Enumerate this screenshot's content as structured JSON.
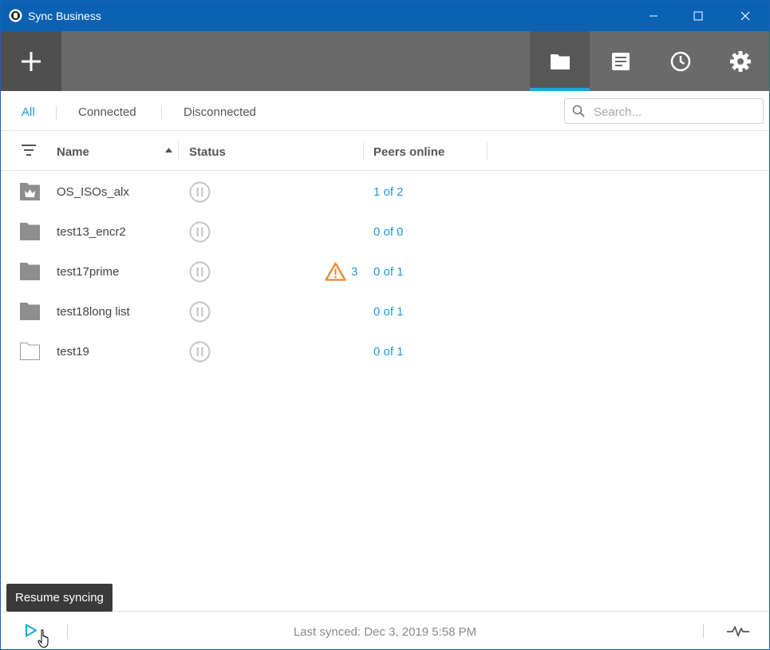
{
  "window": {
    "title": "Sync Business"
  },
  "toolbar": {
    "add_icon": "plus-icon",
    "tabs": [
      {
        "name": "folders",
        "icon": "folder-icon",
        "active": true
      },
      {
        "name": "notes",
        "icon": "notes-icon",
        "active": false
      },
      {
        "name": "history",
        "icon": "clock-icon",
        "active": false
      },
      {
        "name": "settings",
        "icon": "gear-icon",
        "active": false
      }
    ]
  },
  "filters": {
    "tabs": [
      "All",
      "Connected",
      "Disconnected"
    ],
    "active": "All"
  },
  "search": {
    "placeholder": "Search..."
  },
  "table": {
    "columns": {
      "name": "Name",
      "status": "Status",
      "peers": "Peers online"
    },
    "rows": [
      {
        "name": "OS_ISOs_alx",
        "folder_icon": "shared-folder-crown-icon",
        "status": "paused",
        "warnings": "",
        "peers": "1 of 2"
      },
      {
        "name": "test13_encr2",
        "folder_icon": "folder-icon",
        "status": "paused",
        "warnings": "",
        "peers": "0 of 0"
      },
      {
        "name": "test17prime",
        "folder_icon": "folder-icon",
        "status": "paused",
        "warnings": "3",
        "peers": "0 of 1"
      },
      {
        "name": "test18long list",
        "folder_icon": "folder-icon",
        "status": "paused",
        "warnings": "",
        "peers": "0 of 1"
      },
      {
        "name": "test19",
        "folder_icon": "empty-folder-icon",
        "status": "paused",
        "warnings": "",
        "peers": "0 of 1"
      }
    ]
  },
  "footer": {
    "tooltip": "Resume syncing",
    "last_synced": "Last synced: Dec 3, 2019 5:58 PM"
  },
  "colors": {
    "titlebar": "#0b61b4",
    "toolbar": "#6a6a6a",
    "accent": "#1a9bd7",
    "warning": "#f0852d"
  }
}
